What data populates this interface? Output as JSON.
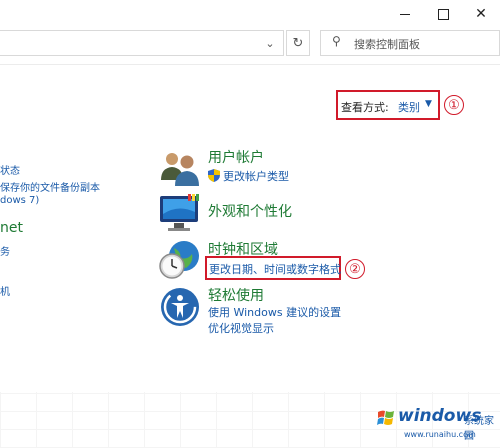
{
  "window": {
    "minimize_icon": "minimize-icon",
    "maximize_icon": "maximize-icon",
    "close_icon": "close-icon"
  },
  "address_bar": {
    "dropdown_icon": "chevron-down-icon",
    "refresh_icon": "refresh-icon"
  },
  "search": {
    "placeholder": "搜索控制面板",
    "icon": "search-icon"
  },
  "view_by": {
    "label": "查看方式:",
    "value": "类别"
  },
  "annotations": [
    "①",
    "②"
  ],
  "left_column": {
    "partial_lines": [
      "状态",
      "保存你的文件备份副本",
      "dows 7)",
      "net",
      "务",
      "机"
    ]
  },
  "categories": [
    {
      "title": "用户帐户",
      "icon": "user-accounts-icon",
      "links": [
        {
          "label": "更改帐户类型",
          "icon": "shield-icon"
        }
      ]
    },
    {
      "title": "外观和个性化",
      "icon": "appearance-icon",
      "links": []
    },
    {
      "title": "时钟和区域",
      "icon": "clock-region-icon",
      "links": [
        {
          "label": "更改日期、时间或数字格式"
        }
      ]
    },
    {
      "title": "轻松使用",
      "icon": "ease-of-access-icon",
      "links": [
        {
          "label": "使用 Windows 建议的设置"
        },
        {
          "label": "优化视觉显示"
        }
      ]
    }
  ],
  "watermark": {
    "brand": "windows",
    "sub": "系统家园",
    "url": "www.runaihu.com"
  },
  "colors": {
    "highlight_red": "#d11a2a",
    "link_blue": "#1a5aa8",
    "category_green": "#1e7a34"
  }
}
